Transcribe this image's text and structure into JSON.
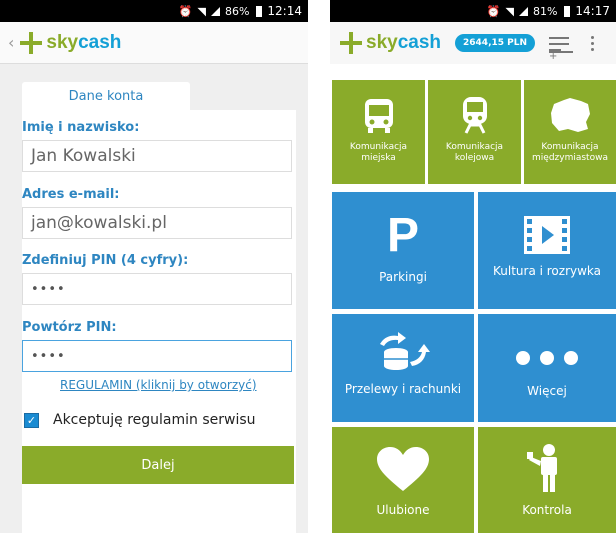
{
  "left_screen": {
    "status": {
      "battery_text": "86%",
      "time": "12:14"
    },
    "back_glyph": "‹",
    "logo": {
      "part1": "sky",
      "part2": "cash"
    },
    "tab_label": "Dane konta",
    "fields": [
      {
        "label": "Imię i nazwisko:",
        "value": "Jan Kowalski"
      },
      {
        "label": "Adres e-mail:",
        "value": "jan@kowalski.pl"
      },
      {
        "label": "Zdefiniuj PIN (4 cyfry):",
        "value": "••••"
      },
      {
        "label": "Powtórz PIN:",
        "value": "••••"
      }
    ],
    "regulamin_link": "REGULAMIN (kliknij by otworzyć)",
    "checkbox_label": "Akceptuję regulamin serwisu",
    "button_label": "Dalej"
  },
  "right_screen": {
    "status": {
      "battery_text": "81%",
      "time": "14:17"
    },
    "logo": {
      "part1": "sky",
      "part2": "cash"
    },
    "balance": "2644,15 PLN",
    "tiles": [
      {
        "label_line1": "Komunikacja",
        "label_line2": "miejska",
        "icon": "bus-icon",
        "color": "#8aab2a"
      },
      {
        "label_line1": "Komunikacja",
        "label_line2": "kolejowa",
        "icon": "train-icon",
        "color": "#8aab2a"
      },
      {
        "label_line1": "Komunikacja",
        "label_line2": "międzymiastowa",
        "icon": "poland-map-icon",
        "color": "#8aab2a"
      },
      {
        "label": "Parkingi",
        "icon": "parking-icon",
        "glyph": "P",
        "color": "#2f8fd0"
      },
      {
        "label": "Kultura i rozrywka",
        "icon": "film-icon",
        "color": "#2f8fd0"
      },
      {
        "label": "Przelewy i rachunki",
        "icon": "transfer-coins-icon",
        "color": "#2f8fd0"
      },
      {
        "label": "Więcej",
        "icon": "more-dots-icon",
        "color": "#2f8fd0"
      },
      {
        "label": "Ulubione",
        "icon": "heart-icon",
        "color": "#8aab2a"
      },
      {
        "label": "Kontrola",
        "icon": "inspector-icon",
        "color": "#8aab2a"
      }
    ]
  },
  "colors": {
    "brand_green": "#8aab2a",
    "brand_blue": "#14a0d6",
    "tile_blue": "#2f8fd0"
  }
}
